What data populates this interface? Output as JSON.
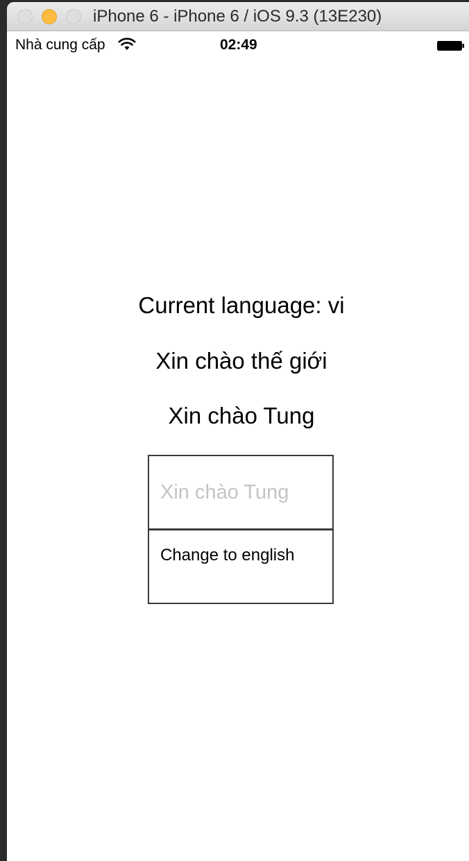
{
  "window": {
    "title": "iPhone 6 - iPhone 6 / iOS 9.3 (13E230)"
  },
  "statusbar": {
    "carrier": "Nhà cung cấp",
    "time": "02:49",
    "wifi_icon": "wifi-icon",
    "battery_icon": "battery-icon"
  },
  "app": {
    "current_language_text": "Current language: vi",
    "hello_world_text": "Xin chào thế giới",
    "hello_user_text": "Xin chào Tung",
    "name_input": {
      "value": "",
      "placeholder": "Xin chào Tung"
    },
    "change_button_label": "Change to english"
  },
  "colors": {
    "minimize_button": "#fdbc40",
    "placeholder_text": "#c4c4c8"
  }
}
